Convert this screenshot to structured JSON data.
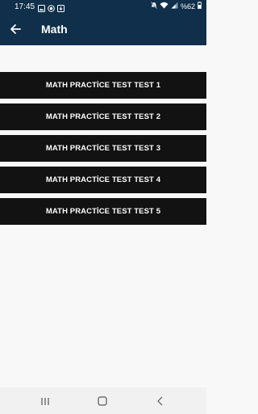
{
  "status_bar": {
    "time": "17:45",
    "battery": "%62",
    "icons": [
      "image-icon",
      "circle-icon",
      "download-icon",
      "mute-icon",
      "wifi-icon",
      "signal-icon",
      "battery-icon"
    ]
  },
  "app_bar": {
    "title": "Math",
    "back_icon": "arrow-left-icon"
  },
  "tests": [
    {
      "label": "MATH PRACTİCE TEST TEST 1"
    },
    {
      "label": "MATH PRACTİCE TEST TEST 2"
    },
    {
      "label": "MATH PRACTİCE TEST TEST 3"
    },
    {
      "label": "MATH PRACTİCE TEST TEST 4"
    },
    {
      "label": "MATH PRACTİCE TEST TEST 5"
    }
  ],
  "nav_bar": {
    "recents_icon": "recents-icon",
    "home_icon": "home-icon",
    "back_icon": "back-chevron-icon"
  },
  "colors": {
    "header": "#0f2f4a",
    "button": "#121212",
    "background": "#f8f8f8",
    "nav": "#f1f1f1"
  }
}
